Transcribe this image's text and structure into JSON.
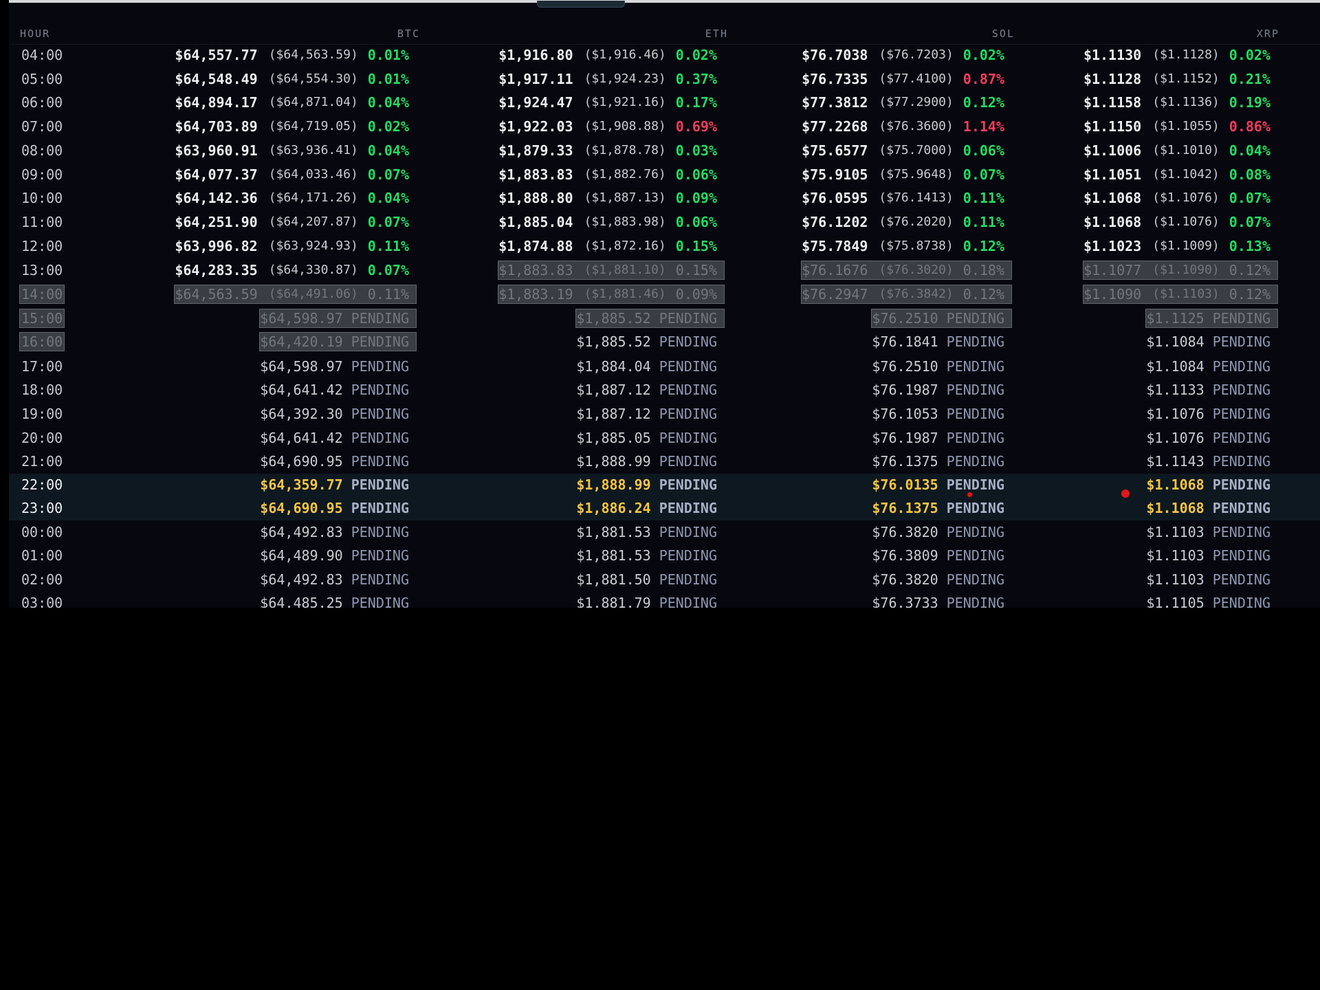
{
  "headers": {
    "hour": "HOUR",
    "btc": "BTC",
    "eth": "ETH",
    "sol": "SOL",
    "xrp": "XRP"
  },
  "colors": {
    "up": "#22dc62",
    "down": "#f03c5c",
    "highlight_price": "#f5c542",
    "pending": "#8e98b0"
  },
  "rows": [
    {
      "hour": "04:00",
      "state": "done",
      "cols": [
        {
          "price": "$64,557.77",
          "prev": "($64,563.59)",
          "chg": "0.01%",
          "dir": "up"
        },
        {
          "price": "$1,916.80",
          "prev": "($1,916.46)",
          "chg": "0.02%",
          "dir": "up"
        },
        {
          "price": "$76.7038",
          "prev": "($76.7203)",
          "chg": "0.02%",
          "dir": "up"
        },
        {
          "price": "$1.1130",
          "prev": "($1.1128)",
          "chg": "0.02%",
          "dir": "up"
        }
      ]
    },
    {
      "hour": "05:00",
      "state": "done",
      "cols": [
        {
          "price": "$64,548.49",
          "prev": "($64,554.30)",
          "chg": "0.01%",
          "dir": "up"
        },
        {
          "price": "$1,917.11",
          "prev": "($1,924.23)",
          "chg": "0.37%",
          "dir": "up"
        },
        {
          "price": "$76.7335",
          "prev": "($77.4100)",
          "chg": "0.87%",
          "dir": "down"
        },
        {
          "price": "$1.1128",
          "prev": "($1.1152)",
          "chg": "0.21%",
          "dir": "up"
        }
      ]
    },
    {
      "hour": "06:00",
      "state": "done",
      "cols": [
        {
          "price": "$64,894.17",
          "prev": "($64,871.04)",
          "chg": "0.04%",
          "dir": "up"
        },
        {
          "price": "$1,924.47",
          "prev": "($1,921.16)",
          "chg": "0.17%",
          "dir": "up"
        },
        {
          "price": "$77.3812",
          "prev": "($77.2900)",
          "chg": "0.12%",
          "dir": "up"
        },
        {
          "price": "$1.1158",
          "prev": "($1.1136)",
          "chg": "0.19%",
          "dir": "up"
        }
      ]
    },
    {
      "hour": "07:00",
      "state": "done",
      "cols": [
        {
          "price": "$64,703.89",
          "prev": "($64,719.05)",
          "chg": "0.02%",
          "dir": "up"
        },
        {
          "price": "$1,922.03",
          "prev": "($1,908.88)",
          "chg": "0.69%",
          "dir": "down"
        },
        {
          "price": "$77.2268",
          "prev": "($76.3600)",
          "chg": "1.14%",
          "dir": "down"
        },
        {
          "price": "$1.1150",
          "prev": "($1.1055)",
          "chg": "0.86%",
          "dir": "down"
        }
      ]
    },
    {
      "hour": "08:00",
      "state": "done",
      "cols": [
        {
          "price": "$63,960.91",
          "prev": "($63,936.41)",
          "chg": "0.04%",
          "dir": "up"
        },
        {
          "price": "$1,879.33",
          "prev": "($1,878.78)",
          "chg": "0.03%",
          "dir": "up"
        },
        {
          "price": "$75.6577",
          "prev": "($75.7000)",
          "chg": "0.06%",
          "dir": "up"
        },
        {
          "price": "$1.1006",
          "prev": "($1.1010)",
          "chg": "0.04%",
          "dir": "up"
        }
      ]
    },
    {
      "hour": "09:00",
      "state": "done",
      "cols": [
        {
          "price": "$64,077.37",
          "prev": "($64,033.46)",
          "chg": "0.07%",
          "dir": "up"
        },
        {
          "price": "$1,883.83",
          "prev": "($1,882.76)",
          "chg": "0.06%",
          "dir": "up"
        },
        {
          "price": "$75.9105",
          "prev": "($75.9648)",
          "chg": "0.07%",
          "dir": "up"
        },
        {
          "price": "$1.1051",
          "prev": "($1.1042)",
          "chg": "0.08%",
          "dir": "up"
        }
      ]
    },
    {
      "hour": "10:00",
      "state": "done",
      "cols": [
        {
          "price": "$64,142.36",
          "prev": "($64,171.26)",
          "chg": "0.04%",
          "dir": "up"
        },
        {
          "price": "$1,888.80",
          "prev": "($1,887.13)",
          "chg": "0.09%",
          "dir": "up"
        },
        {
          "price": "$76.0595",
          "prev": "($76.1413)",
          "chg": "0.11%",
          "dir": "up"
        },
        {
          "price": "$1.1068",
          "prev": "($1.1076)",
          "chg": "0.07%",
          "dir": "up"
        }
      ]
    },
    {
      "hour": "11:00",
      "state": "done",
      "cols": [
        {
          "price": "$64,251.90",
          "prev": "($64,207.87)",
          "chg": "0.07%",
          "dir": "up"
        },
        {
          "price": "$1,885.04",
          "prev": "($1,883.98)",
          "chg": "0.06%",
          "dir": "up"
        },
        {
          "price": "$76.1202",
          "prev": "($76.2020)",
          "chg": "0.11%",
          "dir": "up"
        },
        {
          "price": "$1.1068",
          "prev": "($1.1076)",
          "chg": "0.07%",
          "dir": "up"
        }
      ]
    },
    {
      "hour": "12:00",
      "state": "done",
      "cols": [
        {
          "price": "$63,996.82",
          "prev": "($63,924.93)",
          "chg": "0.11%",
          "dir": "up"
        },
        {
          "price": "$1,874.88",
          "prev": "($1,872.16)",
          "chg": "0.15%",
          "dir": "up"
        },
        {
          "price": "$75.7849",
          "prev": "($75.8738)",
          "chg": "0.12%",
          "dir": "up"
        },
        {
          "price": "$1.1023",
          "prev": "($1.1009)",
          "chg": "0.13%",
          "dir": "up"
        }
      ]
    },
    {
      "hour": "13:00",
      "state": "done",
      "cols": [
        {
          "price": "$64,283.35",
          "prev": "($64,330.87)",
          "chg": "0.07%",
          "dir": "up"
        },
        {
          "price": "$1,883.83",
          "prev": "($1,881.10)",
          "chg": "0.15%",
          "dir": "up",
          "dim": true
        },
        {
          "price": "$76.1676",
          "prev": "($76.3020)",
          "chg": "0.18%",
          "dir": "up",
          "dim": true
        },
        {
          "price": "$1.1077",
          "prev": "($1.1090)",
          "chg": "0.12%",
          "dir": "up",
          "dim": true
        }
      ]
    },
    {
      "hour": "14:00",
      "state": "done",
      "hour_dim": true,
      "cols": [
        {
          "price": "$64,563.59",
          "prev": "($64,491.06)",
          "chg": "0.11%",
          "dir": "up",
          "dim": true
        },
        {
          "price": "$1,883.19",
          "prev": "($1,881.46)",
          "chg": "0.09%",
          "dir": "up",
          "dim": true
        },
        {
          "price": "$76.2947",
          "prev": "($76.3842)",
          "chg": "0.12%",
          "dir": "up",
          "dim": true
        },
        {
          "price": "$1.1090",
          "prev": "($1.1103)",
          "chg": "0.12%",
          "dir": "up",
          "dim": true
        }
      ]
    },
    {
      "hour": "15:00",
      "state": "pending",
      "hour_dim": true,
      "cols": [
        {
          "price": "$64,598.97",
          "status": "PENDING",
          "dim": true
        },
        {
          "price": "$1,885.52",
          "status": "PENDING",
          "dim": true
        },
        {
          "price": "$76.2510",
          "status": "PENDING",
          "dim": true
        },
        {
          "price": "$1.1125",
          "status": "PENDING",
          "dim": true
        }
      ]
    },
    {
      "hour": "16:00",
      "state": "pending",
      "hour_dim": true,
      "cols": [
        {
          "price": "$64,420.19",
          "status": "PENDING",
          "dim": true
        },
        {
          "price": "$1,885.52",
          "status": "PENDING"
        },
        {
          "price": "$76.1841",
          "status": "PENDING"
        },
        {
          "price": "$1.1084",
          "status": "PENDING"
        }
      ]
    },
    {
      "hour": "17:00",
      "state": "pending",
      "cols": [
        {
          "price": "$64,598.97",
          "status": "PENDING"
        },
        {
          "price": "$1,884.04",
          "status": "PENDING"
        },
        {
          "price": "$76.2510",
          "status": "PENDING"
        },
        {
          "price": "$1.1084",
          "status": "PENDING"
        }
      ]
    },
    {
      "hour": "18:00",
      "state": "pending",
      "cols": [
        {
          "price": "$64,641.42",
          "status": "PENDING"
        },
        {
          "price": "$1,887.12",
          "status": "PENDING"
        },
        {
          "price": "$76.1987",
          "status": "PENDING"
        },
        {
          "price": "$1.1133",
          "status": "PENDING"
        }
      ]
    },
    {
      "hour": "19:00",
      "state": "pending",
      "cols": [
        {
          "price": "$64,392.30",
          "status": "PENDING"
        },
        {
          "price": "$1,887.12",
          "status": "PENDING"
        },
        {
          "price": "$76.1053",
          "status": "PENDING"
        },
        {
          "price": "$1.1076",
          "status": "PENDING"
        }
      ]
    },
    {
      "hour": "20:00",
      "state": "pending",
      "cols": [
        {
          "price": "$64,641.42",
          "status": "PENDING"
        },
        {
          "price": "$1,885.05",
          "status": "PENDING"
        },
        {
          "price": "$76.1987",
          "status": "PENDING"
        },
        {
          "price": "$1.1076",
          "status": "PENDING"
        }
      ]
    },
    {
      "hour": "21:00",
      "state": "pending",
      "cols": [
        {
          "price": "$64,690.95",
          "status": "PENDING"
        },
        {
          "price": "$1,888.99",
          "status": "PENDING"
        },
        {
          "price": "$76.1375",
          "status": "PENDING"
        },
        {
          "price": "$1.1143",
          "status": "PENDING"
        }
      ]
    },
    {
      "hour": "22:00",
      "state": "pending",
      "highlight": true,
      "cols": [
        {
          "price": "$64,359.77",
          "status": "PENDING"
        },
        {
          "price": "$1,888.99",
          "status": "PENDING"
        },
        {
          "price": "$76.0135",
          "status": "PENDING"
        },
        {
          "price": "$1.1068",
          "status": "PENDING"
        }
      ]
    },
    {
      "hour": "23:00",
      "state": "pending",
      "highlight": true,
      "cols": [
        {
          "price": "$64,690.95",
          "status": "PENDING"
        },
        {
          "price": "$1,886.24",
          "status": "PENDING"
        },
        {
          "price": "$76.1375",
          "status": "PENDING"
        },
        {
          "price": "$1.1068",
          "status": "PENDING"
        }
      ]
    },
    {
      "hour": "00:00",
      "state": "pending",
      "cols": [
        {
          "price": "$64,492.83",
          "status": "PENDING"
        },
        {
          "price": "$1,881.53",
          "status": "PENDING"
        },
        {
          "price": "$76.3820",
          "status": "PENDING"
        },
        {
          "price": "$1.1103",
          "status": "PENDING"
        }
      ]
    },
    {
      "hour": "01:00",
      "state": "pending",
      "cols": [
        {
          "price": "$64,489.90",
          "status": "PENDING"
        },
        {
          "price": "$1,881.53",
          "status": "PENDING"
        },
        {
          "price": "$76.3809",
          "status": "PENDING"
        },
        {
          "price": "$1.1103",
          "status": "PENDING"
        }
      ]
    },
    {
      "hour": "02:00",
      "state": "pending",
      "cols": [
        {
          "price": "$64,492.83",
          "status": "PENDING"
        },
        {
          "price": "$1,881.50",
          "status": "PENDING"
        },
        {
          "price": "$76.3820",
          "status": "PENDING"
        },
        {
          "price": "$1.1103",
          "status": "PENDING"
        }
      ]
    },
    {
      "hour": "03:00",
      "state": "pending",
      "cols": [
        {
          "price": "$64,485.25",
          "status": "PENDING"
        },
        {
          "price": "$1,881.79",
          "status": "PENDING"
        },
        {
          "price": "$76.3733",
          "status": "PENDING"
        },
        {
          "price": "$1.1105",
          "status": "PENDING"
        }
      ]
    }
  ]
}
